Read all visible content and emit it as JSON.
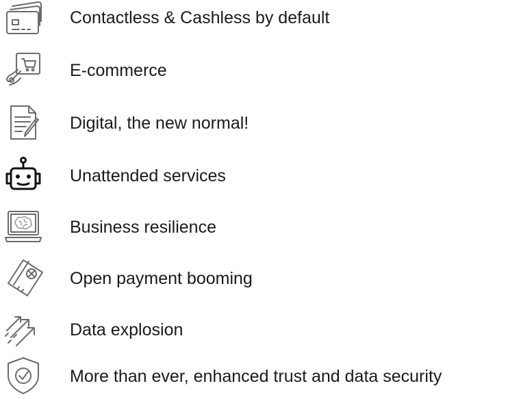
{
  "items": [
    {
      "icon": "card-icon",
      "label": "Contactless & Cashless by default"
    },
    {
      "icon": "ecommerce-cart-icon",
      "label": "E-commerce"
    },
    {
      "icon": "document-pen-icon",
      "label": "Digital, the new normal!"
    },
    {
      "icon": "robot-icon",
      "label": "Unattended services"
    },
    {
      "icon": "laptop-brain-icon",
      "label": "Business resilience"
    },
    {
      "icon": "payment-ticket-icon",
      "label": "Open payment booming"
    },
    {
      "icon": "arrows-growth-icon",
      "label": "Data explosion"
    },
    {
      "icon": "shield-check-icon",
      "label": "More than ever, enhanced trust and data security"
    }
  ]
}
